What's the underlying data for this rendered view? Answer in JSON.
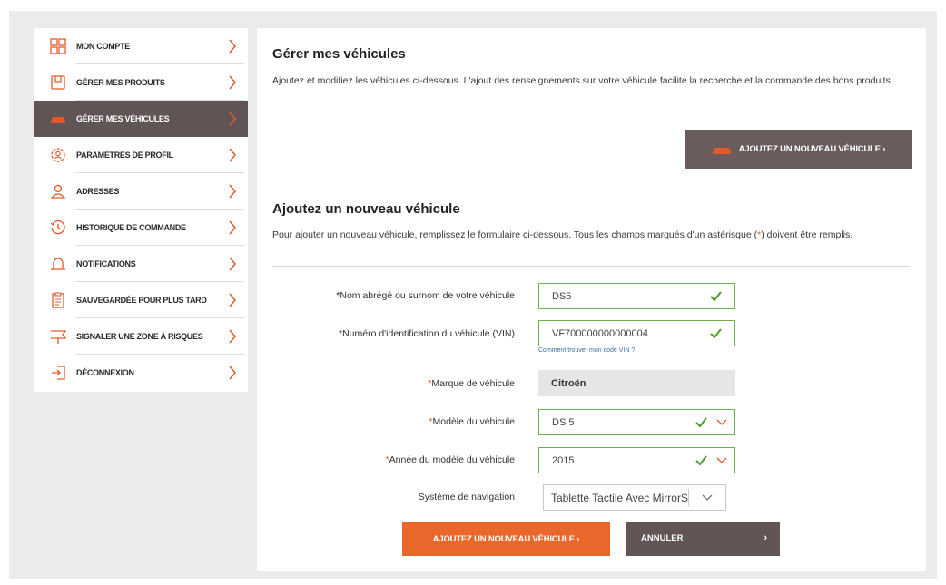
{
  "sidebar": {
    "items": [
      {
        "label": "MON COMPTE",
        "icon": "grid-icon"
      },
      {
        "label": "GÉRER MES PRODUITS",
        "icon": "product-box-icon"
      },
      {
        "label": "GÉRER MES VÉHICULES",
        "icon": "car-icon",
        "active": true
      },
      {
        "label": "PARAMÈTRES DE PROFIL",
        "icon": "settings-gear-icon"
      },
      {
        "label": "ADRESSES",
        "icon": "address-person-icon"
      },
      {
        "label": "HISTORIQUE DE COMMANDE",
        "icon": "history-clock-icon"
      },
      {
        "label": "NOTIFICATIONS",
        "icon": "bell-icon"
      },
      {
        "label": "SAUVEGARDÉE POUR PLUS TARD",
        "icon": "clipboard-icon"
      },
      {
        "label": "SIGNALER UNE ZONE À RISQUES",
        "icon": "warning-sign-icon"
      },
      {
        "label": "DÉCONNEXION",
        "icon": "logout-icon"
      }
    ]
  },
  "main": {
    "title": "Gérer mes véhicules",
    "intro": "Ajoutez et modifiez les véhicules ci-dessous. L'ajout des renseignements sur votre véhicule facilite la recherche et la commande des bons produits.",
    "add_top_label": "AJOUTEZ UN NOUVEAU VÉHICULE ›",
    "form_title": "Ajoutez un nouveau véhicule",
    "form_intro_before": "Pour ajouter un nouveau véhicule, remplissez le formulaire ci-dessous. Tous les champs marqués d'un astérisque (",
    "form_intro_star": "*",
    "form_intro_after": ") doivent être remplis."
  },
  "form": {
    "nickname": {
      "label": "*Nom abrégé ou surnom de votre véhicule",
      "value": "DS5"
    },
    "vin": {
      "label": "*Numéro d'identification du véhicule (VIN)",
      "value": "VF700000000000004",
      "help": "Comment trouver mon code VIN ?"
    },
    "make": {
      "star": "*",
      "label": "Marque de véhicule",
      "value": "Citroën"
    },
    "model": {
      "star": "*",
      "label": "Modèle du véhicule",
      "value": "DS 5"
    },
    "year": {
      "star": "*",
      "label": "Année du modèle du véhicule",
      "value": "2015"
    },
    "nav": {
      "label": "Système de navigation",
      "value": "Tablette Tactile Avec MirrorS"
    }
  },
  "actions": {
    "add_label": "AJOUTEZ UN NOUVEAU VÉHICULE  ›",
    "cancel_label": "ANNULER",
    "cancel_chevron": "›"
  },
  "colors": {
    "accent_orange": "#e9672a",
    "active_nav": "#605455",
    "valid_green": "#6fb04c",
    "required_star": "#e35a2a"
  }
}
